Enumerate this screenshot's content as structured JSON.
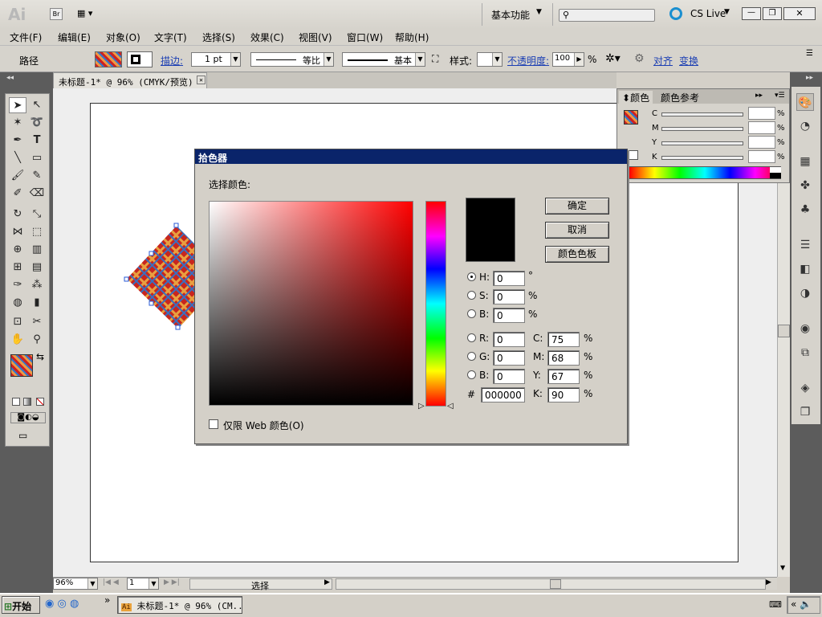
{
  "app": {
    "logo": "Ai",
    "bridge": "Br",
    "workspace": "基本功能",
    "cslive": "CS Live",
    "search_placeholder": ""
  },
  "menu": [
    "文件(F)",
    "编辑(E)",
    "对象(O)",
    "文字(T)",
    "选择(S)",
    "效果(C)",
    "视图(V)",
    "窗口(W)",
    "帮助(H)"
  ],
  "control": {
    "object_type": "路径",
    "stroke_label": "描边:",
    "stroke_weight": "1 pt",
    "profile_label": "等比",
    "brush_label": "基本",
    "style_label": "样式:",
    "opacity_label": "不透明度:",
    "opacity_value": "100",
    "opacity_unit": "%",
    "align_label": "对齐",
    "transform_label": "变换"
  },
  "document": {
    "tab_title": "未标题-1* @ 96% (CMYK/预览)"
  },
  "color_panel": {
    "tab_color": "颜色",
    "tab_guide": "颜色参考",
    "channels": [
      {
        "label": "C",
        "value": "",
        "unit": "%"
      },
      {
        "label": "M",
        "value": "",
        "unit": "%"
      },
      {
        "label": "Y",
        "value": "",
        "unit": "%"
      },
      {
        "label": "K",
        "value": "",
        "unit": "%"
      }
    ]
  },
  "dialog": {
    "title": "拾色器",
    "prompt": "选择颜色:",
    "ok": "确定",
    "cancel": "取消",
    "swatches": "颜色色板",
    "h_label": "H:",
    "h_value": "0",
    "h_unit": "°",
    "s_label": "S:",
    "s_value": "0",
    "s_unit": "%",
    "b_label": "B:",
    "b_value": "0",
    "b_unit": "%",
    "r_label": "R:",
    "r_value": "0",
    "g_label": "G:",
    "g_value": "0",
    "bb_label": "B:",
    "bb_value": "0",
    "c_label": "C:",
    "c_value": "75",
    "c_unit": "%",
    "m_label": "M:",
    "m_value": "68",
    "m_unit": "%",
    "y_label": "Y:",
    "y_value": "67",
    "y_unit": "%",
    "k_label": "K:",
    "k_value": "90",
    "k_unit": "%",
    "hex_label": "#",
    "hex_value": "000000",
    "web_only": "仅限 Web 颜色(O)"
  },
  "status": {
    "zoom": "96%",
    "page": "1",
    "tool": "选择"
  },
  "taskbar": {
    "start": "开始",
    "task": "未标题-1* @ 96% (CM..."
  }
}
